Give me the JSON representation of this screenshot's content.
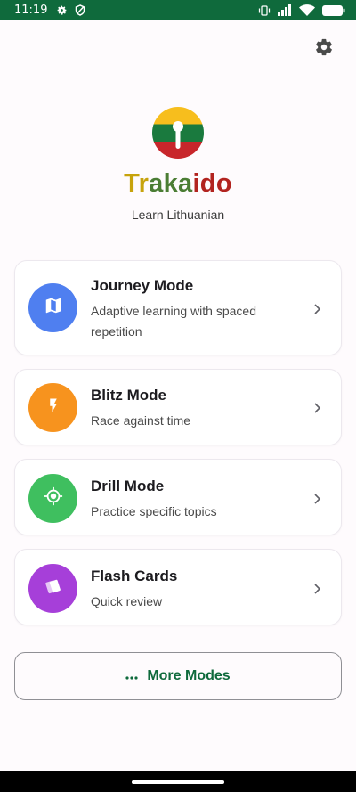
{
  "status_bar": {
    "time": "11:19",
    "icons": [
      "settings-icon",
      "shield-icon",
      "vibrate-icon",
      "signal-icon",
      "wifi-icon",
      "battery-icon"
    ],
    "background": "#0f6a3c"
  },
  "header": {
    "settings_icon": "gear-icon",
    "logo_icon": "lithuanian-flag-keyhole-logo",
    "title_parts": [
      "Tr",
      "aka",
      "ido"
    ],
    "title_colors": [
      "#c7a30c",
      "#4b7d34",
      "#b2231f"
    ],
    "subtitle": "Learn Lithuanian"
  },
  "modes": [
    {
      "title": "Journey Mode",
      "description": "Adaptive learning with spaced repetition",
      "icon": "map-icon",
      "color": "#4f7ff0"
    },
    {
      "title": "Blitz Mode",
      "description": "Race against time",
      "icon": "lightning-icon",
      "color": "#f7931e"
    },
    {
      "title": "Drill Mode",
      "description": "Practice specific topics",
      "icon": "target-icon",
      "color": "#3fbf5f"
    },
    {
      "title": "Flash Cards",
      "description": "Quick review",
      "icon": "cards-icon",
      "color": "#a63fd9"
    }
  ],
  "more_modes": {
    "label": "More Modes",
    "icon": "more-dots-icon"
  },
  "accent_color": "#0f6a3c"
}
